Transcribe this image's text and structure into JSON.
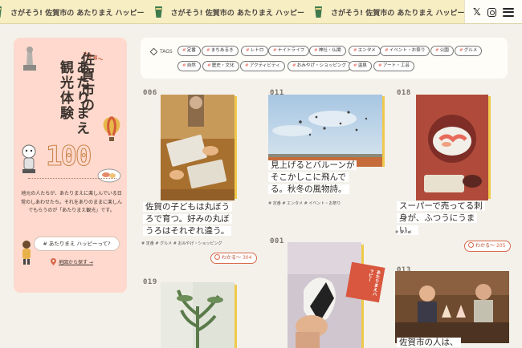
{
  "banner": {
    "repeat_text": "さがそう! 佐賀市の あたりまえ ハッピー",
    "repeat_count": 4,
    "icons": [
      "x-icon",
      "instagram-icon",
      "menu-icon"
    ],
    "x_glyph": "𝕏"
  },
  "sidebar": {
    "wakaru": "わかる〜",
    "title_line1": "佐賀市の",
    "title_line2": "あたりまえ",
    "title_line3": "観光体験",
    "count": "100",
    "description": "地元の人たちが、あたりまえに楽しんでいる日常のしあわせたち。それをありのままに楽しんでもらうのが「あたりまえ観光」です。",
    "happy_button": "# あたりまえ ハッピーって?",
    "map_link": "地図から探す →"
  },
  "tags": {
    "label": "TAGS",
    "items": [
      "定番",
      "まちあるき",
      "レトロ",
      "ナイトライフ",
      "神社・仏閣",
      "エンタメ",
      "イベント・お祭り",
      "公園",
      "グルメ",
      "自然",
      "歴史・文化",
      "アクティビティ",
      "おみやげ・ショッピング",
      "温泉",
      "アート・工芸"
    ]
  },
  "cards": [
    {
      "id": "006",
      "caption": "佐賀の子どもは丸ぼうろで育つ。好みの丸ぼうろはそれぞれ違う。",
      "tags": "# 定番 # グルメ # おみやげ・ショッピング",
      "wakaru": "わかる〜",
      "count": "304"
    },
    {
      "id": "011",
      "caption": "見上げるとバルーンがそこかしこに飛んでる。秋冬の風物詩。",
      "tags": "# 定番 # エンタメ # イベント・お祭り"
    },
    {
      "id": "018",
      "caption": "スーパーで売ってる刺身が、ふつうにうまい。",
      "tags": "# グルメ",
      "wakaru": "わかる〜",
      "count": "205"
    },
    {
      "id": "001",
      "caption": "",
      "tags": "",
      "badge": "あたりまえハッピー"
    },
    {
      "id": "019",
      "caption": ""
    },
    {
      "id": "013",
      "caption": "佐賀市の人は、",
      "tags": ""
    }
  ],
  "colors": {
    "banner_bg": "#f7eec4",
    "sidebar_bg": "#ffd9cd",
    "accent": "#d8694b",
    "page_bg": "#f3f1ea"
  }
}
